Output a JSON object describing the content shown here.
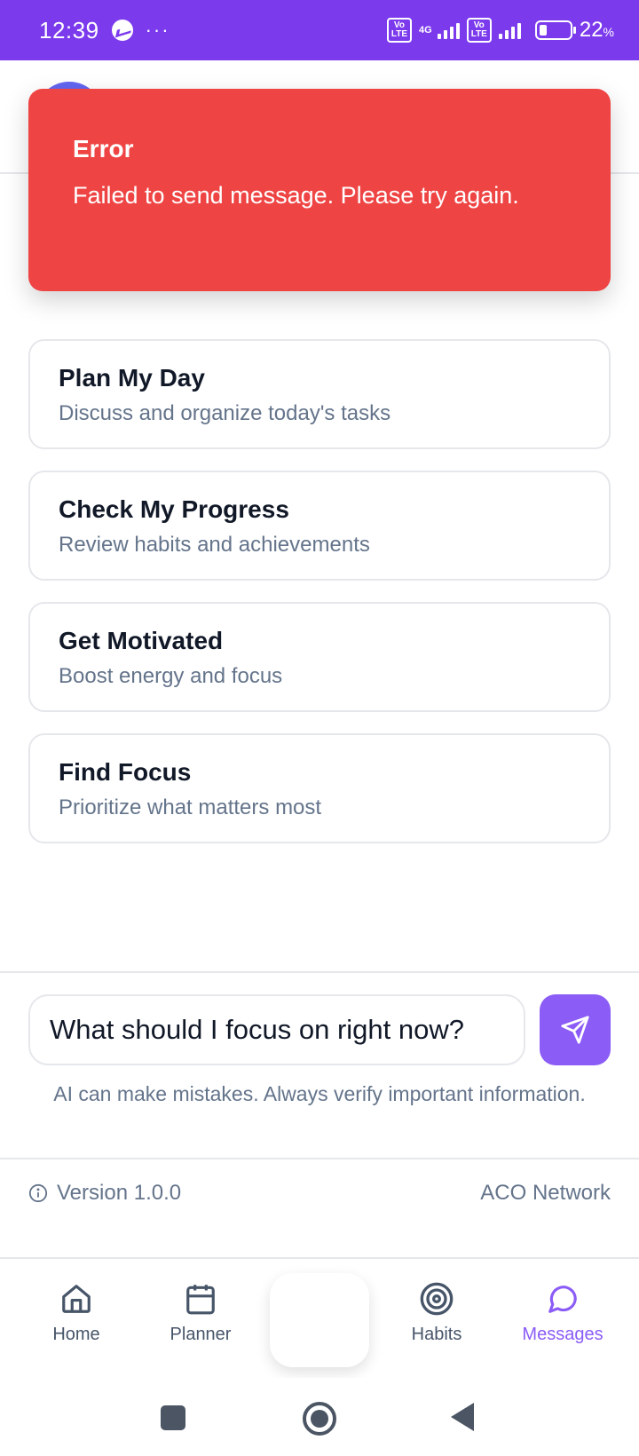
{
  "status_bar": {
    "time": "12:39",
    "messenger_icon": "messenger-icon",
    "more": "···",
    "volte1": "Vo\nLTE",
    "network": "4G",
    "volte2": "Vo\nLTE",
    "battery_pct": "22",
    "battery_unit": "%"
  },
  "toast": {
    "title": "Error",
    "message": "Failed to send message. Please try again."
  },
  "quick_actions": [
    {
      "title": "Plan My Day",
      "description": "Discuss and organize today's tasks"
    },
    {
      "title": "Check My Progress",
      "description": "Review habits and achievements"
    },
    {
      "title": "Get Motivated",
      "description": "Boost energy and focus"
    },
    {
      "title": "Find Focus",
      "description": "Prioritize what matters most"
    }
  ],
  "composer": {
    "value": "What should I focus on right now?",
    "send_icon": "send-icon",
    "disclaimer": "AI can make mistakes. Always verify important information."
  },
  "footer": {
    "version": "Version 1.0.0",
    "network": "ACO Network"
  },
  "nav": {
    "items": [
      {
        "label": "Home",
        "icon": "home-icon"
      },
      {
        "label": "Planner",
        "icon": "calendar-icon"
      },
      {
        "label": "Habits",
        "icon": "target-icon"
      },
      {
        "label": "Messages",
        "icon": "message-icon"
      }
    ],
    "active": "Messages"
  },
  "colors": {
    "primary": "#7c3aed",
    "accent": "#8b5cf6",
    "error": "#ef4444",
    "muted": "#64748b"
  }
}
